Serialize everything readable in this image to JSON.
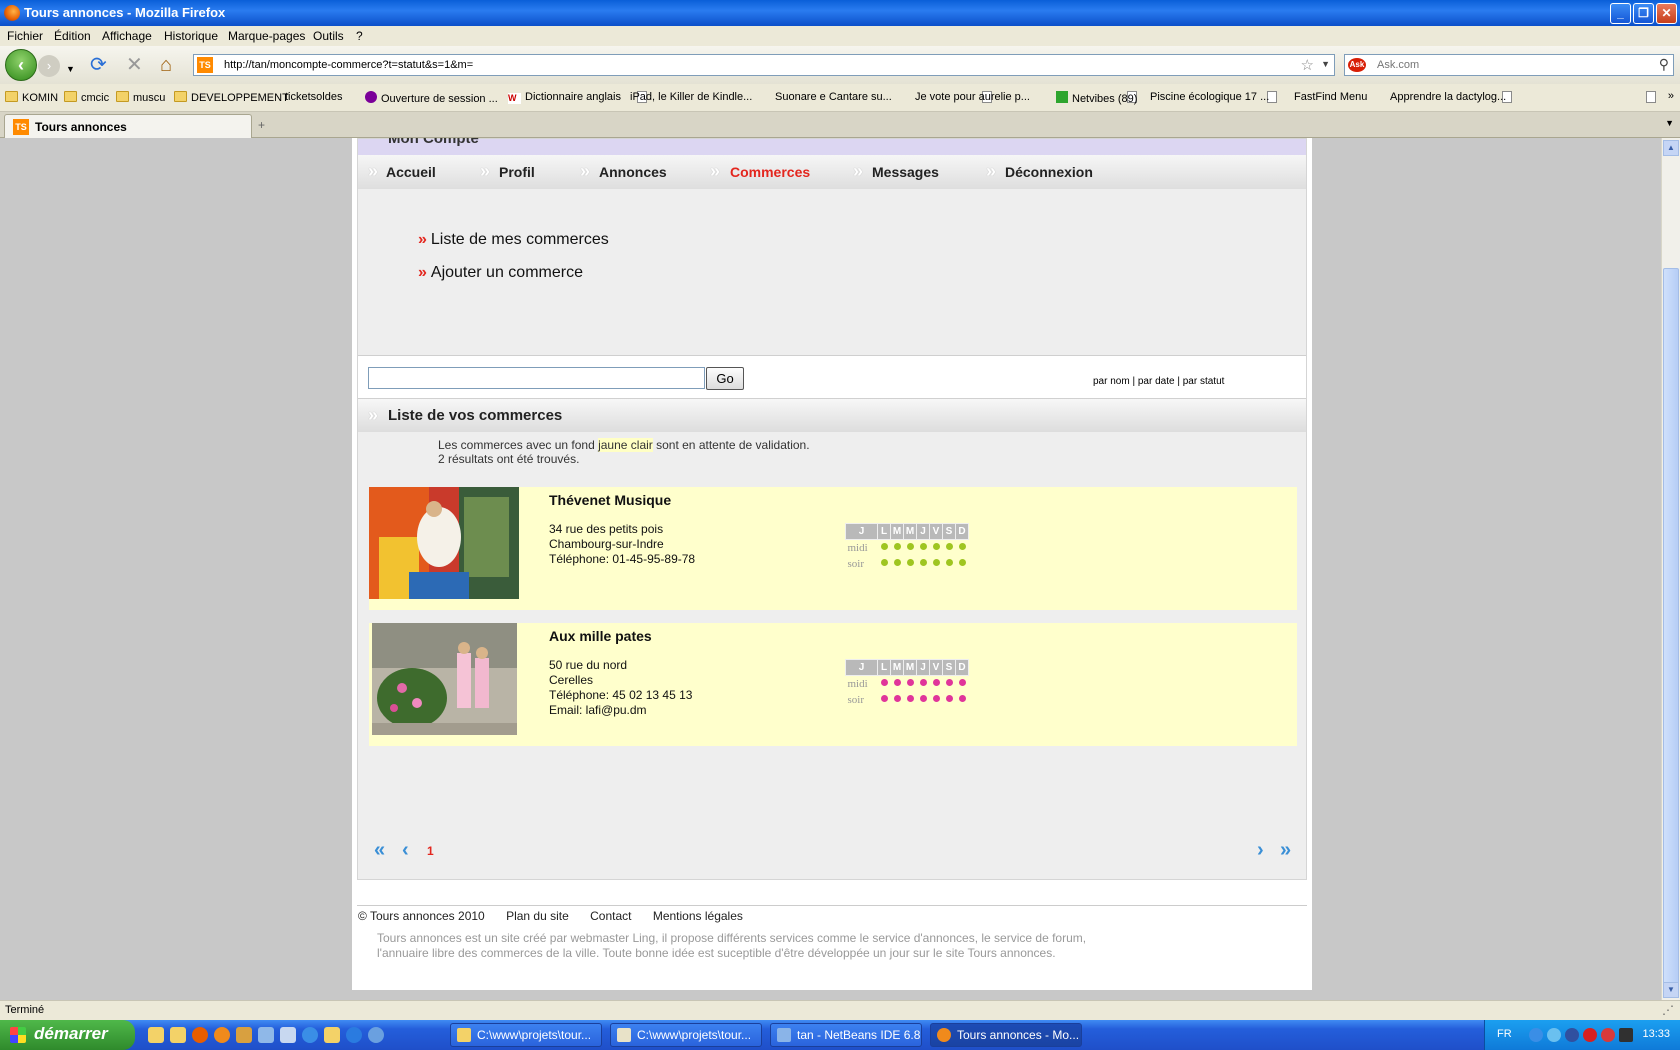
{
  "window": {
    "title": "Tours annonces - Mozilla Firefox"
  },
  "menu": [
    "Fichier",
    "Édition",
    "Affichage",
    "Historique",
    "Marque-pages",
    "Outils",
    "?"
  ],
  "nav": {
    "url": "http://tan/moncompte-commerce?t=statut&s=1&m=",
    "search_placeholder": "Ask.com"
  },
  "bookmarks": [
    {
      "label": "KOMIN",
      "icon": "folder-icon"
    },
    {
      "label": "cmcic",
      "icon": "folder-icon"
    },
    {
      "label": "muscu",
      "icon": "folder-icon"
    },
    {
      "label": "DEVELOPPEMENT",
      "icon": "folder-icon"
    },
    {
      "label": "ticketsoldes",
      "icon": "page-icon"
    },
    {
      "label": "Ouverture de session ...",
      "icon": "yahoo-icon"
    },
    {
      "label": "Dictionnaire anglais",
      "icon": "wordreference-icon"
    },
    {
      "label": "iPad, le Killer de Kindle...",
      "icon": "page-icon"
    },
    {
      "label": "Suonare e Cantare su...",
      "icon": "page-icon"
    },
    {
      "label": "Je vote pour aurelie p...",
      "icon": "page-icon"
    },
    {
      "label": "Netvibes (89)",
      "icon": "netvibes-icon"
    },
    {
      "label": "Piscine écologique 17 ...",
      "icon": "page-icon"
    },
    {
      "label": "FastFind Menu",
      "icon": "page-icon"
    },
    {
      "label": "Apprendre la dactylog...",
      "icon": "page-icon"
    }
  ],
  "tab": {
    "label": "Tours annonces",
    "favicon_text": "TS"
  },
  "site": {
    "section_title": "Mon Compte",
    "main_nav": [
      "Accueil",
      "Profil",
      "Annonces",
      "Commerces",
      "Messages",
      "Déconnexion"
    ],
    "main_nav_active": "Commerces",
    "submenu": [
      "Liste de mes commerces",
      "Ajouter un commerce"
    ],
    "search": {
      "value": "",
      "go_label": "Go"
    },
    "sort": {
      "by_name": "par nom",
      "by_date": "par date",
      "by_status": "par statut",
      "sep": "|"
    },
    "list_title": "Liste de vos commerces",
    "info_before": "Les commerces avec un fond ",
    "info_highlight": "jaune clair",
    "info_after": " sont en attente de validation.",
    "results": "2 résultats ont été trouvés.",
    "hours_header": [
      "J",
      "L",
      "M",
      "M",
      "J",
      "V",
      "S",
      "D"
    ],
    "hours_rows": [
      "midi",
      "soir"
    ],
    "items": [
      {
        "name": "Thévenet Musique",
        "address": "34 rue des petits pois",
        "city": "Chambourg-sur-Indre",
        "phone": "Téléphone: 01-45-95-89-78",
        "email": "",
        "dot_color": "#9fc520"
      },
      {
        "name": "Aux mille pates",
        "address": "50 rue du nord",
        "city": "Cerelles",
        "phone": "Téléphone: 45 02 13 45 13",
        "email": "Email: lafi@pu.dm",
        "dot_color": "#e0359a"
      }
    ],
    "pager": {
      "first": "«",
      "prev": "‹",
      "current": "1",
      "next": "›",
      "last": "»"
    },
    "footer": {
      "copyright": "© Tours annonces 2010",
      "links": [
        "Plan du site",
        "Contact",
        "Mentions légales"
      ],
      "text": "Tours annonces est un site créé par webmaster Ling, il propose différents services comme le service d'annonces, le service de forum, l'annuaire libre des commerces de la ville. Toute bonne idée est suceptible d'être développée un jour sur le site Tours annonces."
    }
  },
  "status": "Terminé",
  "taskbar": {
    "start": "démarrer",
    "buttons": [
      "C:\\www\\projets\\tour...",
      "C:\\www\\projets\\tour...",
      "tan - NetBeans IDE 6.8",
      "Tours annonces - Mo..."
    ],
    "lang": "FR",
    "clock": "13:33"
  },
  "colors": {
    "accent_red": "#e3261e",
    "pending_bg": "#ffffcc",
    "pager_blue": "#3a8fd6"
  }
}
